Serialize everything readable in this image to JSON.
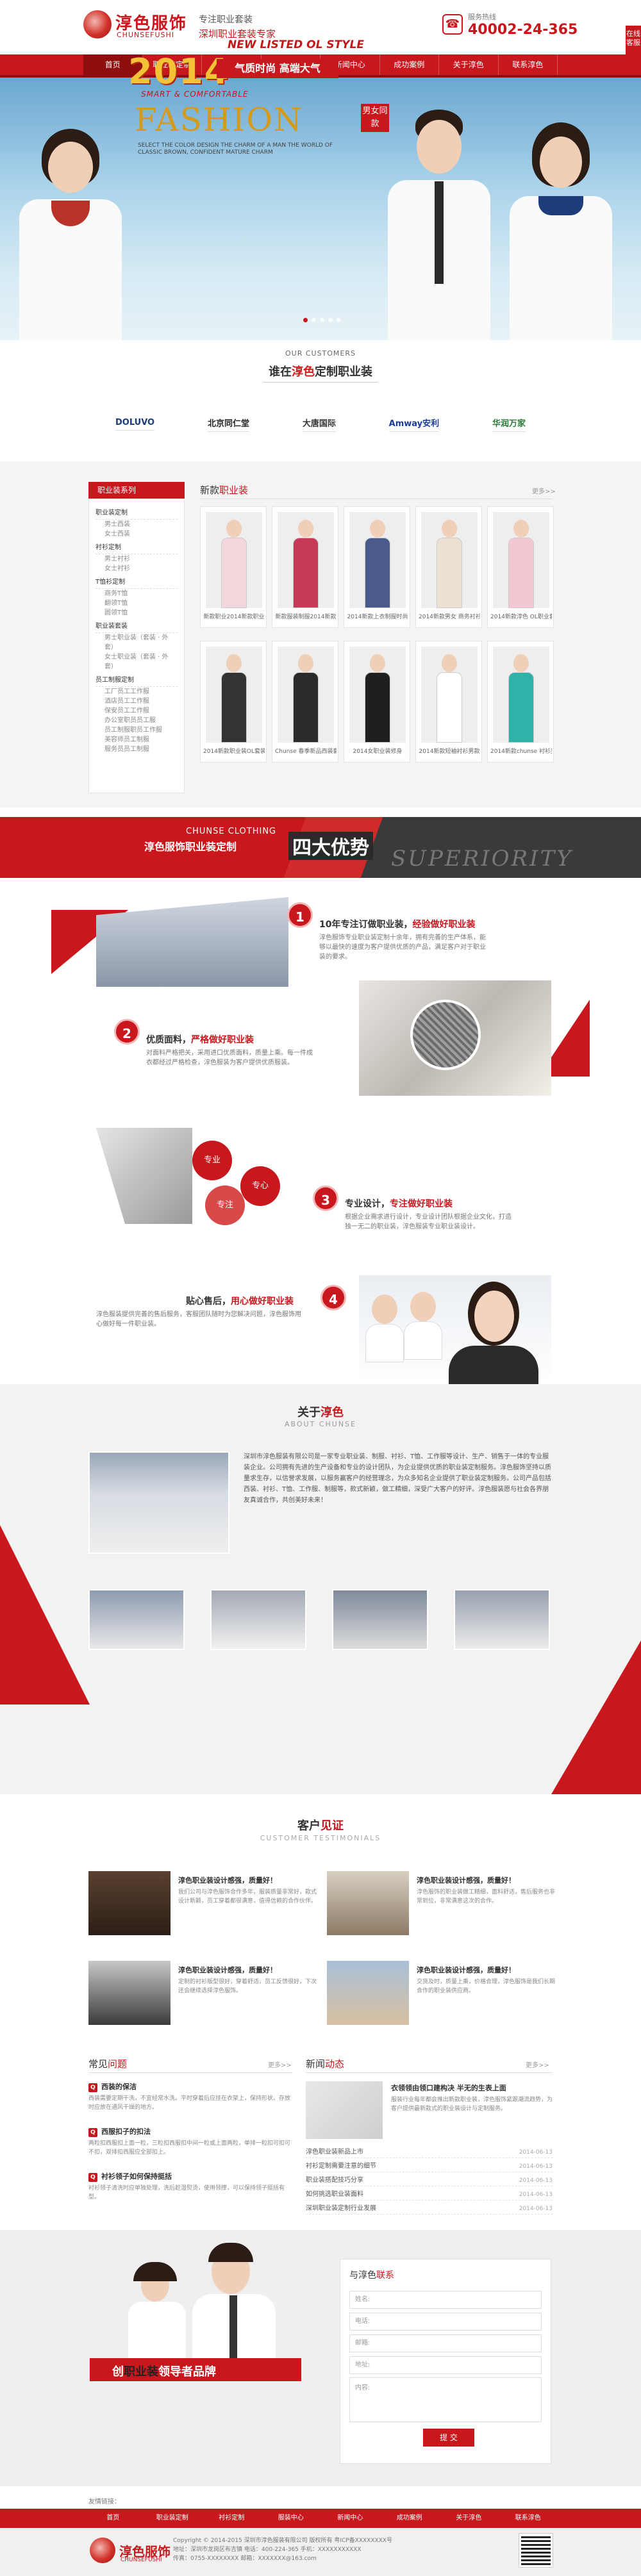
{
  "header": {
    "logo_cn": "淳色服饰",
    "logo_en": "CHUNSEFUSHI",
    "slogan1": "专注职业套装",
    "slogan2": "深圳职业套装专家",
    "hotline_label": "服务热线",
    "hotline": "40002-24-365",
    "side_tab": "在线客服"
  },
  "nav": [
    "首页",
    "职业装定制",
    "衬衫定制",
    "服装中心",
    "新闻中心",
    "成功案例",
    "关于淳色",
    "联系淳色"
  ],
  "hero": {
    "year": "2014",
    "new_listed": "NEW LISTED OL STYLE",
    "bar": "气质时尚 高端大气",
    "sub": "SMART & COMFORTABLE",
    "fashion": "FASHION",
    "tag": "男女同款",
    "small": "SELECT THE COLOR DESIGN THE CHARM OF A MAN THE WORLD OF CLASSIC BROWN, CONFIDENT MATURE CHARM",
    "dots": 5
  },
  "customers": {
    "en": "OUR CUSTOMERS",
    "cn_pre": "谁在",
    "cn_brand": "淳色",
    "cn_post": "定制职业装",
    "logos": [
      "DOLUVO",
      "北京同仁堂",
      "大唐国际",
      "Amway安利",
      "华润万家"
    ]
  },
  "products": {
    "side_title": "职业装系列",
    "side": [
      {
        "cat": "职业装定制",
        "subs": [
          "男士西装",
          "女士西装"
        ]
      },
      {
        "cat": "衬衫定制",
        "subs": [
          "男士衬衫",
          "女士衬衫"
        ]
      },
      {
        "cat": "T恤衫定制",
        "subs": [
          "商务T恤",
          "翻领T恤",
          "圆领T恤"
        ]
      },
      {
        "cat": "职业装套装",
        "subs": [
          "男士职业装（套装 · 外套）",
          "女士职业装（套装 · 外套）"
        ]
      },
      {
        "cat": "员工制服定制",
        "subs": [
          "工厂员工工作服",
          "酒店员工工作服",
          "保安员工工作服",
          "办公室职员员工服",
          "员工制服职员工作服",
          "美容师员工制服",
          "服务员员工制服"
        ]
      }
    ],
    "title_pre": "新款",
    "title_hl": "职业装",
    "more": "更多>>",
    "items": [
      {
        "caption": "新款职业2014新款职业",
        "color": "#f2d8dc"
      },
      {
        "caption": "新款服装制服2014新款",
        "color": "#c43a58"
      },
      {
        "caption": "2014新款上衣制服时尚",
        "color": "#4a5a8a"
      },
      {
        "caption": "2014新款男女 商务衬衫",
        "color": "#ece1d0"
      },
      {
        "caption": "2014新款淳色 OL职业套装",
        "color": "#f4c8d2"
      },
      {
        "caption": "2014新款职业装OL套装",
        "color": "#333333"
      },
      {
        "caption": "Chunse 春季新品西装套装",
        "color": "#2a2a2a"
      },
      {
        "caption": "2014女职业装修身",
        "color": "#1f1f1f"
      },
      {
        "caption": "2014新款短袖衬衫男款",
        "color": "#ffffff"
      },
      {
        "caption": "2014新款chunse 衬衫男款",
        "color": "#2fb3a8"
      }
    ]
  },
  "advantage": {
    "en": "CHUNSE CLOTHING",
    "cn": "淳色服饰职业装定制",
    "big": "四大优势",
    "sup": "SUPERIORITY",
    "items": [
      {
        "num": "1",
        "pre": "10年专注订做职业装，",
        "hl": "经验做好职业装",
        "text": "淳色服饰专业职业装定制十余年，拥有完善的生产体系，能够以最快的速度为客户提供优质的产品，满足客户对于职业装的要求。"
      },
      {
        "num": "2",
        "pre": "优质面料，",
        "hl": "严格做好职业装",
        "text": "对面料严格把关，采用进口优质面料，质量上乘。每一件成衣都经过严格检查，淳色服装为客户提供优质服装。"
      },
      {
        "num": "3",
        "pre": "专业设计，",
        "hl": "专注做好职业装",
        "text": "根据企业需求进行设计，专业设计团队根据企业文化，打造独一无二的职业装，淳色服装专业职业装设计。"
      },
      {
        "num": "4",
        "pre": "贴心售后，",
        "hl": "用心做好职业装",
        "text": "淳色服装提供完善的售后服务，客服团队随时为您解决问题，淳色服饰用心做好每一件职业装。"
      }
    ],
    "circles": [
      "专业",
      "专心",
      "专注"
    ]
  },
  "about": {
    "title_pre": "关于",
    "title_hl": "淳色",
    "en": "ABOUT CHUNSE",
    "text": "深圳市淳色服装有限公司是一家专业职业装、制服、衬衫、T恤、工作服等设计、生产、销售于一体的专业服装企业。公司拥有先进的生产设备和专业的设计团队，为企业提供优质的职业装定制服务。淳色服饰坚持以质量求生存，以信誉求发展，以服务赢客户的经营理念，为众多知名企业提供了职业装定制服务。公司产品包括西装、衬衫、T恤、工作服、制服等，款式新颖，做工精细，深受广大客户的好评。淳色服装愿与社会各界朋友真诚合作，共创美好未来！"
  },
  "testimonials": {
    "title_pre": "客户",
    "title_hl": "见证",
    "en": "CUSTOMER TESTIMONIALS",
    "items": [
      {
        "name": "淳色职业装设计感强，质量好！",
        "text": "我们公司与淳色服饰合作多年，服装质量非常好，款式设计新颖，员工穿着都很满意，值得信赖的合作伙伴。"
      },
      {
        "name": "淳色职业装设计感强，质量好！",
        "text": "淳色服饰的职业装做工精细，面料舒适，售后服务也非常到位，非常满意这次的合作。"
      },
      {
        "name": "淳色职业装设计感强，质量好！",
        "text": "定制的衬衫版型很好，穿着舒适，员工反馈很好，下次还会继续选择淳色服饰。"
      },
      {
        "name": "淳色职业装设计感强，质量好！",
        "text": "交货及时，质量上乘，价格合理，淳色服饰是我们长期合作的职业装供应商。"
      }
    ]
  },
  "faq": {
    "title_pre": "常见",
    "title_hl": "问题",
    "more": "更多>>",
    "items": [
      {
        "q": "西装的保洁",
        "a": "西装需要定期干洗，不宜经常水洗。平时穿着后应挂在衣架上，保持形状。存放时应放在通风干燥的地方。"
      },
      {
        "q": "西服扣子的扣法",
        "a": "两粒扣西服扣上面一粒，三粒扣西服扣中间一粒或上面两粒，单排一粒扣可扣可不扣，双排扣西服应全部扣上。"
      },
      {
        "q": "衬衫领子如何保持挺括",
        "a": "衬衫领子清洗时应单独处理，洗后趁湿熨烫，使用领撑，可以保持领子挺括有型。"
      }
    ]
  },
  "news": {
    "title_pre": "新闻",
    "title_hl": "动态",
    "more": "更多>>",
    "feature_title": "衣领领由领口建构决 半无的生表上面",
    "feature_text": "服装行业每年都会推出新款职业装，淳色服饰紧跟潮流趋势，为客户提供最新款式的职业装设计与定制服务。",
    "items": [
      {
        "title": "淳色职业装新品上市",
        "date": "2014-06-13"
      },
      {
        "title": "衬衫定制需要注意的细节",
        "date": "2014-06-13"
      },
      {
        "title": "职业装搭配技巧分享",
        "date": "2014-06-13"
      },
      {
        "title": "如何挑选职业装面料",
        "date": "2014-06-13"
      },
      {
        "title": "深圳职业装定制行业发展",
        "date": "2014-06-13"
      }
    ]
  },
  "contact": {
    "slogan_pre": "创",
    "slogan_hl": "职业装",
    "slogan_post": "领导者品牌",
    "form_title_pre": "与淳色",
    "form_title_hl": "联系",
    "fields": [
      "姓名:",
      "电话:",
      "邮箱:",
      "地址:"
    ],
    "message": "内容:",
    "submit": "提 交"
  },
  "links": "友情链接：",
  "footer": {
    "nav": [
      "首页",
      "职业装定制",
      "衬衫定制",
      "服装中心",
      "新闻中心",
      "成功案例",
      "关于淳色",
      "联系淳色"
    ],
    "logo_cn": "淳色服饰",
    "logo_en": "CHUNSEFUSHI",
    "line1": "Copyright © 2014-2015 深圳市淳色服装有限公司 版权所有 粤ICP备XXXXXXXX号",
    "line2": "地址：深圳市龙岗区布吉镇 电话：400-224-365 手机：XXXXXXXXXXX",
    "line3": "传真：0755-XXXXXXXX 邮箱：XXXXXXX@163.com"
  }
}
